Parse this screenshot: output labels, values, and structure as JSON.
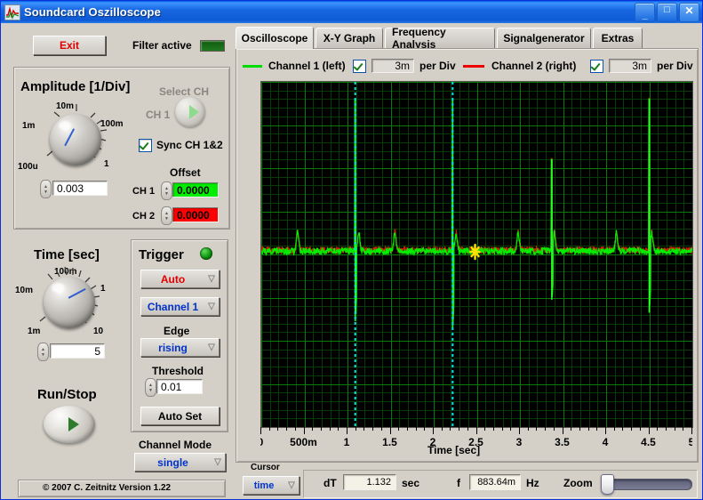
{
  "window": {
    "title": "Soundcard Oszilloscope",
    "icon": "waveform-icon",
    "minimize": "_",
    "maximize": "□",
    "close": "✕"
  },
  "toolbar": {
    "exit_label": "Exit",
    "filter_label": "Filter active",
    "filter_state": "off"
  },
  "amplitude": {
    "title": "Amplitude [1/Div]",
    "knob_ticks": [
      "100u",
      "1m",
      "10m",
      "100m",
      "1"
    ],
    "value": "0.003",
    "select_ch_label": "Select CH",
    "ch_label": "CH 1",
    "sync_label": "Sync CH 1&2",
    "sync_checked": true,
    "offset_title": "Offset",
    "offset_ch1_label": "CH 1",
    "offset_ch1_value": "0.0000",
    "offset_ch1_color": "#00ee00",
    "offset_ch2_label": "CH 2",
    "offset_ch2_value": "0.0000",
    "offset_ch2_color": "#ff0000"
  },
  "time": {
    "title": "Time [sec]",
    "knob_ticks": [
      "1m",
      "10m",
      "100m",
      "1",
      "10"
    ],
    "value": "5"
  },
  "runstop": {
    "label": "Run/Stop"
  },
  "trigger": {
    "title": "Trigger",
    "led": "on",
    "mode": "Auto",
    "source": "Channel 1",
    "edge_label": "Edge",
    "edge": "rising",
    "threshold_label": "Threshold",
    "threshold": "0.01",
    "autoset_label": "Auto Set"
  },
  "channel_mode": {
    "label": "Channel Mode",
    "value": "single"
  },
  "footer": {
    "copyright": "© 2007   C. Zeitnitz Version 1.22"
  },
  "tabs": [
    {
      "label": "Oscilloscope",
      "active": true
    },
    {
      "label": "X-Y Graph",
      "active": false
    },
    {
      "label": "Frequency Analysis",
      "active": false
    },
    {
      "label": "Signalgenerator",
      "active": false
    },
    {
      "label": "Extras",
      "active": false
    }
  ],
  "channels": [
    {
      "name": "Channel 1 (left)",
      "color": "#00dd00",
      "enabled": true,
      "per_div_value": "3m",
      "per_div_label": "per Div"
    },
    {
      "name": "Channel 2 (right)",
      "color": "#ee0000",
      "enabled": true,
      "per_div_value": "3m",
      "per_div_label": "per Div"
    }
  ],
  "cursor": {
    "label": "Cursor",
    "mode": "time",
    "dt_label": "dT",
    "dt_value": "1.132",
    "dt_unit": "sec",
    "f_label": "f",
    "f_value": "883.64m",
    "f_unit": "Hz",
    "zoom_label": "Zoom",
    "zoom_value": 0
  },
  "chart_data": {
    "type": "line",
    "title": "",
    "xlabel": "Time [sec]",
    "ylabel": "",
    "xlim": [
      0,
      5
    ],
    "ylim": [
      -4,
      4
    ],
    "xticks": [
      "0",
      "500m",
      "1",
      "1.5",
      "2",
      "2.5",
      "3",
      "3.5",
      "4",
      "4.5",
      "5"
    ],
    "xtick_values": [
      0,
      0.5,
      1,
      1.5,
      2,
      2.5,
      3,
      3.5,
      4,
      4.5,
      5
    ],
    "grid": true,
    "grid_color": "#0a7a0a",
    "grid_minor_color": "#063d06",
    "background": "#000000",
    "major_divisions_x": 10,
    "major_divisions_y": 8,
    "minor_per_major": 5,
    "cursors": [
      {
        "name": "cursor-1",
        "x": 1.09,
        "color": "#00e8e8"
      },
      {
        "name": "cursor-2",
        "x": 2.22,
        "color": "#00e8e8"
      }
    ],
    "cursor_marker": {
      "name": "cursor-crosshair",
      "x": 2.48,
      "y": 0.06,
      "color": "#ffe000"
    },
    "series": [
      {
        "name": "Channel 1 (left)",
        "color": "#00ee00",
        "baseline": 0.08
      },
      {
        "name": "Channel 2 (right)",
        "color": "#cc2200",
        "baseline": 0.08
      }
    ],
    "spikes": [
      {
        "x": 1.09,
        "top": 3.6,
        "bottom": -1.55
      },
      {
        "x": 2.22,
        "top": 3.6,
        "bottom": -1.7
      },
      {
        "x": 3.37,
        "top": 2.2,
        "bottom": -1.05
      },
      {
        "x": 4.5,
        "top": 3.6,
        "bottom": -1.35
      }
    ],
    "beats": [
      0.42,
      1.13,
      1.55,
      2.26,
      2.98,
      3.4,
      4.12,
      4.53
    ]
  }
}
